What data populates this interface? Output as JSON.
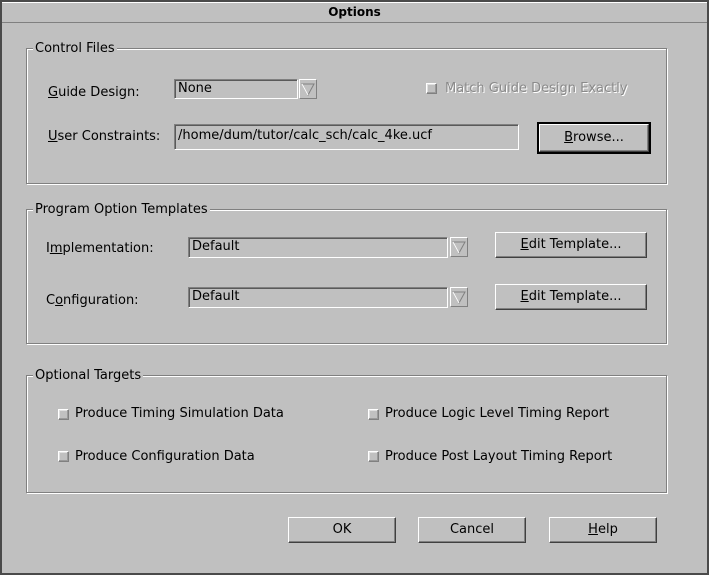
{
  "window": {
    "title": "Options"
  },
  "control_files": {
    "legend": "Control Files",
    "guide_design": {
      "label_u": "G",
      "label_rest": "uide Design:",
      "value": "None"
    },
    "match_guide": {
      "label": "Match Guide Design Exactly",
      "checked": false,
      "enabled": false
    },
    "user_constraints": {
      "label_u": "U",
      "label_rest": "ser Constraints:",
      "value": "/home/dum/tutor/calc_sch/calc_4ke.ucf"
    },
    "browse": {
      "label_u": "B",
      "label_rest": "rowse..."
    }
  },
  "templates": {
    "legend": "Program Option Templates",
    "implementation": {
      "label_pre": "I",
      "label_u": "m",
      "label_rest": "plementation:",
      "value": "Default"
    },
    "configuration": {
      "label_pre": "C",
      "label_u": "o",
      "label_rest": "nfiguration:",
      "value": "Default"
    },
    "edit_impl": {
      "label_u": "E",
      "label_rest": "dit Template..."
    },
    "edit_config": {
      "label_u": "E",
      "label_rest": "dit Template..."
    }
  },
  "targets": {
    "legend": "Optional Targets",
    "timing_sim": {
      "label": "Produce Timing Simulation Data",
      "checked": false
    },
    "config_data": {
      "label": "Produce Configuration Data",
      "checked": false
    },
    "logic_level": {
      "label": "Produce Logic Level Timing Report",
      "checked": false
    },
    "post_layout": {
      "label": "Produce Post Layout Timing Report",
      "checked": false
    }
  },
  "footer": {
    "ok": "OK",
    "cancel": "Cancel",
    "help_u": "H",
    "help_rest": "elp"
  }
}
